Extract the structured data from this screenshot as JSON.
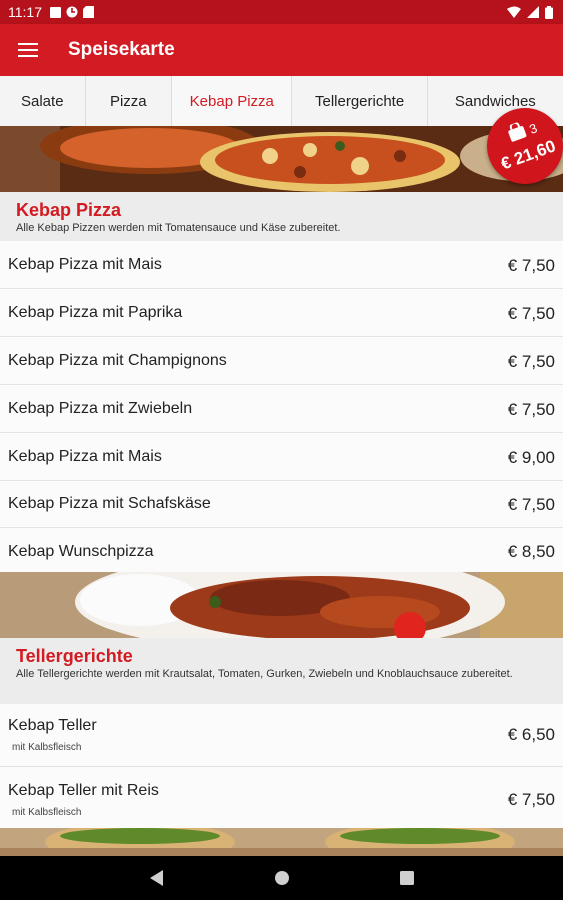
{
  "status": {
    "time": "11:17"
  },
  "appbar": {
    "title": "Speisekarte"
  },
  "tabs": [
    {
      "label": "Salate"
    },
    {
      "label": "Pizza"
    },
    {
      "label": "Kebap Pizza"
    },
    {
      "label": "Tellergerichte"
    },
    {
      "label": "Sandwiches"
    }
  ],
  "active_tab": "Kebap Pizza",
  "cart": {
    "count": "3",
    "total": "€ 21,60"
  },
  "sections": [
    {
      "title": "Kebap Pizza",
      "description": "Alle Kebap Pizzen werden mit Tomatensauce und Käse zubereitet.",
      "items": [
        {
          "name": "Kebap Pizza mit Mais",
          "price": "€ 7,50"
        },
        {
          "name": "Kebap Pizza mit Paprika",
          "price": "€ 7,50"
        },
        {
          "name": "Kebap Pizza mit Champignons",
          "price": "€ 7,50"
        },
        {
          "name": "Kebap Pizza mit Zwiebeln",
          "price": "€ 7,50"
        },
        {
          "name": "Kebap Pizza mit Mais",
          "price": "€ 9,00"
        },
        {
          "name": "Kebap Pizza mit Schafskäse",
          "price": "€ 7,50"
        },
        {
          "name": "Kebap Wunschpizza",
          "price": "€ 8,50"
        }
      ]
    },
    {
      "title": "Tellergerichte",
      "description": "Alle Tellergerichte werden mit Krautsalat, Tomaten, Gurken, Zwiebeln und Knoblauchsauce zubereitet.",
      "items": [
        {
          "name": "Kebap Teller",
          "note": "mit Kalbsfleisch",
          "price": "€ 6,50"
        },
        {
          "name": "Kebap Teller mit Reis",
          "note": "mit Kalbsfleisch",
          "price": "€ 7,50"
        }
      ]
    }
  ],
  "colors": {
    "primary": "#d21b22",
    "status_bar": "#b5121b",
    "nav_bar": "#000000"
  }
}
